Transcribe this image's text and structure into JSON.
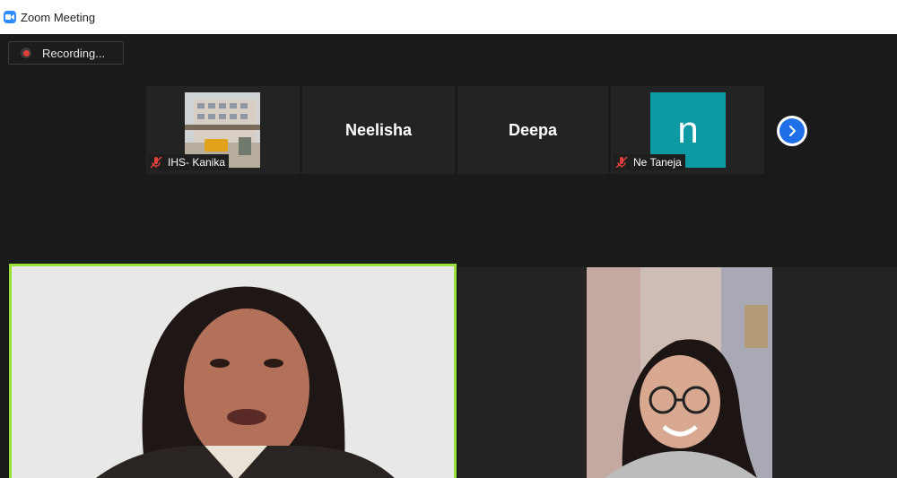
{
  "window": {
    "title": "Zoom Meeting",
    "icon": "zoom-camera-icon",
    "accent": "#2d8cff"
  },
  "recording": {
    "label": "Recording...",
    "icon": "record-dot-icon",
    "dot_color": "#e0413a"
  },
  "participants_strip": [
    {
      "name": "IHS- Kanika",
      "muted": true,
      "display": "video"
    },
    {
      "name": "Neelisha",
      "display": "name"
    },
    {
      "name": "Deepa",
      "display": "name"
    },
    {
      "name": "Ne Taneja",
      "muted": true,
      "display": "avatar",
      "avatar_letter": "n",
      "avatar_color": "#0e9aa5"
    }
  ],
  "navigation": {
    "next_icon": "chevron-right-icon",
    "next_color": "#1f6fe8"
  },
  "active_speaker": {
    "highlight_color": "#9be038"
  }
}
